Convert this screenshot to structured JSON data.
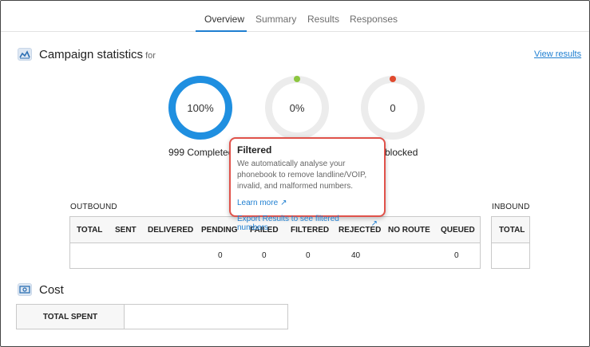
{
  "tabs": [
    "Overview",
    "Summary",
    "Results",
    "Responses"
  ],
  "active_tab": "Overview",
  "stats": {
    "title": "Campaign statistics",
    "for_text": "for",
    "view_results": "View results",
    "rings": [
      {
        "value": "100%",
        "label": "999 Completed",
        "progress": 1.0,
        "color": "#1f8fe0"
      },
      {
        "value": "0%",
        "label": "",
        "progress": 0,
        "dot_color": "#8cc63f"
      },
      {
        "value": "0",
        "label": "blocked",
        "progress": 0,
        "dot_color": "#e04a2e"
      }
    ]
  },
  "tooltip": {
    "title": "Filtered",
    "body": [
      "We automatically analyse your",
      "phonebook to remove landline/VOIP,",
      "invalid, and malformed numbers."
    ],
    "learn_more": "Learn more",
    "export": "Export Results to see filtered numbers"
  },
  "outbound": {
    "label": "OUTBOUND",
    "headers": [
      "TOTAL",
      "SENT",
      "DELIVERED",
      "PENDING",
      "FAILED",
      "FILTERED",
      "REJECTED",
      "NO ROUTE",
      "QUEUED"
    ],
    "values": [
      "",
      "",
      "",
      "0",
      "0",
      "0",
      "40",
      "",
      "0"
    ]
  },
  "inbound": {
    "label": "INBOUND",
    "headers": [
      "TOTAL"
    ],
    "values": [
      ""
    ]
  },
  "cost": {
    "title": "Cost",
    "total_spent_label": "TOTAL SPENT",
    "total_spent_value": ""
  }
}
